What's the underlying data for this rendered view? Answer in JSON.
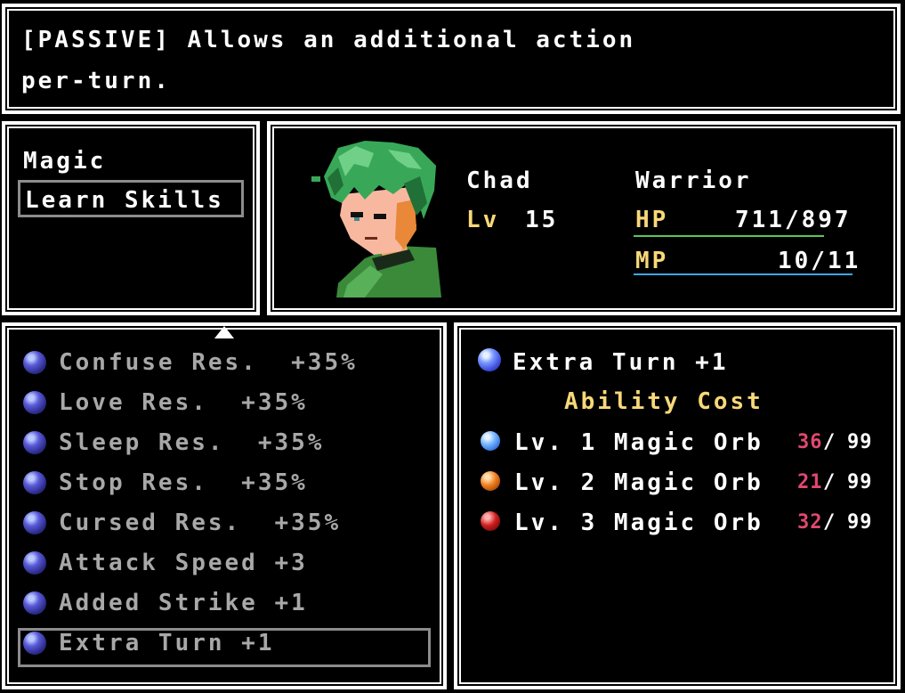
{
  "description_box": {
    "line1": "[PASSIVE] Allows an additional action",
    "line2": "per-turn."
  },
  "menu": {
    "items": [
      {
        "label": "Magic"
      },
      {
        "label": "Learn Skills",
        "selected": true
      }
    ]
  },
  "character": {
    "name": "Chad",
    "class": "Warrior",
    "level_label": "Lv",
    "level": "15",
    "hp_label": "HP",
    "hp_value": "711/897",
    "mp_label": "MP",
    "mp_value": "10/11",
    "hp_bar_color": "#58c858",
    "mp_bar_color": "#3aa8e8"
  },
  "skills": {
    "items": [
      {
        "label": "Confuse Res.  +35%"
      },
      {
        "label": "Love Res.  +35%"
      },
      {
        "label": "Sleep Res.  +35%"
      },
      {
        "label": "Stop Res.  +35%"
      },
      {
        "label": "Cursed Res.  +35%"
      },
      {
        "label": "Attack Speed +3"
      },
      {
        "label": "Added Strike +1"
      },
      {
        "label": "Extra Turn +1",
        "selected": true
      }
    ]
  },
  "detail": {
    "skill_name": "Extra Turn +1",
    "cost_title": "Ability Cost",
    "costs": [
      {
        "label": "Lv. 1 Magic Orb",
        "have": "36",
        "sep": "/",
        "max": "99",
        "orb_color": "blue"
      },
      {
        "label": "Lv. 2 Magic Orb",
        "have": "21",
        "sep": "/",
        "max": "99",
        "orb_color": "orange"
      },
      {
        "label": "Lv. 3 Magic Orb",
        "have": "32",
        "sep": "/",
        "max": "99",
        "orb_color": "red"
      }
    ]
  }
}
